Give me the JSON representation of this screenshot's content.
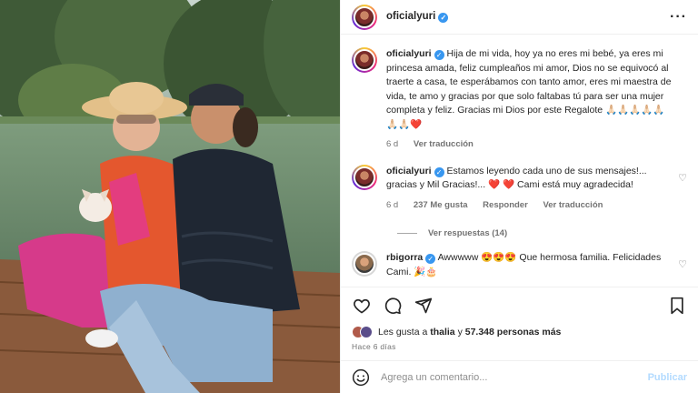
{
  "post": {
    "username": "oficialyuri",
    "more_icon": "more-options-icon"
  },
  "caption": {
    "username": "oficialyuri",
    "text": "Hija de mi vida, hoy ya no eres mi bebé, ya eres mi princesa amada, feliz cumpleaños mi amor, Dios no se equivocó al traerte a casa, te esperábamos con tanto amor, eres mi maestra de vida, te amo y gracias por que solo faltabas tú para ser una mujer completa y feliz. Gracias mi Dios por este Regalote",
    "emojis": "🙏🏻🙏🏻🙏🏻🙏🏻🙏🏻🙏🏻🙏🏻❤️",
    "age": "6 d",
    "translate": "Ver traducción"
  },
  "comments": [
    {
      "username": "oficialyuri",
      "text": "Estamos leyendo cada uno de sus mensajes!... gracias y Mil Gracias!...",
      "hearts": "❤️ ❤️",
      "text2": "Cami está muy agradecida!",
      "age": "6 d",
      "likes": "237 Me gusta",
      "reply": "Responder",
      "translate": "Ver traducción",
      "view_replies": "Ver respuestas (14)"
    },
    {
      "username": "rbigorra",
      "prefix": "Awwwww",
      "emojis": "😍😍😍",
      "text": "Que hermosa familia. Felicidades Cami.",
      "emojis2": "🎉🎂"
    }
  ],
  "actions": {
    "like_icon": "heart-icon",
    "comment_icon": "comment-icon",
    "share_icon": "share-icon",
    "save_icon": "bookmark-icon"
  },
  "likes": {
    "prefix": "Les gusta a",
    "user": "thalia",
    "joiner": "y",
    "count": "57.348 personas más"
  },
  "posted_ago": "Hace 6 días",
  "composer": {
    "placeholder": "Agrega un comentario...",
    "publish": "Publicar"
  }
}
